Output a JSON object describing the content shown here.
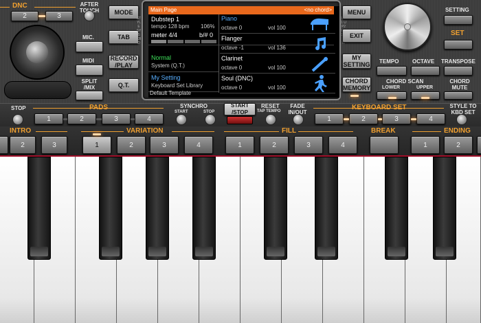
{
  "top_left": {
    "dnc": "DNC",
    "dnc_buttons": [
      "2",
      "3"
    ],
    "after_touch": "AFTER TOUCH",
    "mic": "MIC.",
    "midi": "MIDI",
    "split_mix": "SPLIT /MIX"
  },
  "center_left": {
    "mode": "MODE",
    "tab": "TAB",
    "record_play": "RECORD /PLAY",
    "qt": "Q.T."
  },
  "display": {
    "header_title": "Main Page",
    "header_chord": "<no chord>",
    "side_left": "STYLE SYS KBD",
    "side_right": "UP1 UP2 UP3 LOW",
    "style": {
      "name": "Dubstep 1",
      "tempo": "tempo 128 bpm",
      "pct": "106%",
      "meter": "meter 4/4",
      "bfx": "b/# 0"
    },
    "sys": {
      "label": "Normal",
      "detail": "System (Q.T.)"
    },
    "kbd": {
      "label": "My Setting",
      "detail": "Keyboard Set Library"
    },
    "parts": [
      {
        "name": "Piano",
        "octave": "octave 0",
        "vol": "vol 100",
        "icon": "piano-icon"
      },
      {
        "name": "Flanger",
        "octave": "octave -1",
        "vol": "vol 136",
        "icon": "note-icon"
      },
      {
        "name": "Clarinet",
        "octave": "octave 0",
        "vol": "vol 100",
        "icon": "clarinet-icon"
      },
      {
        "name": "Soul (DNC)",
        "octave": "octave 0",
        "vol": "vol 100",
        "icon": "dancer-icon"
      }
    ],
    "footer": "Default Template"
  },
  "right_panel": {
    "menu": "MENU",
    "exit": "EXIT",
    "my_setting": "MY SETTING",
    "chord_memory": "CHORD MEMORY",
    "setting": "SETTING",
    "set": "SET",
    "tempo": "TEMPO",
    "octave": "OCTAVE",
    "transpose": "TRANSPOSE",
    "chord_scan": "CHORD SCAN",
    "lower": "LOWER",
    "upper": "UPPER",
    "chord_mute": "CHORD MUTE"
  },
  "strip2": {
    "stop": "STOP",
    "pads": "PADS",
    "pad_buttons": [
      "1",
      "2",
      "3",
      "4"
    ],
    "synchro": "SYNCHRO",
    "start": "START",
    "stop2": "STOP",
    "start_stop": "START /STOP",
    "reset": "RESET",
    "tap_tempo": "TAP TEMPO",
    "fade": "FADE IN/OUT",
    "keyboard_set": "KEYBOARD SET",
    "kbd_buttons": [
      "1",
      "2",
      "3",
      "4"
    ],
    "style_to_kbd": "STYLE TO KBD SET"
  },
  "strip3": {
    "intro": "INTRO",
    "variation": "VARIATION",
    "fill": "FILL",
    "break": "BREAK",
    "ending": "ENDING",
    "intro_buttons": [
      "2",
      "3"
    ],
    "variation_buttons": [
      "1",
      "2",
      "3",
      "4"
    ],
    "fill_buttons": [
      "1",
      "2"
    ],
    "ending_buttons": [
      "1",
      "2"
    ],
    "tail_fill": "3",
    "tail_fill2": "4"
  }
}
